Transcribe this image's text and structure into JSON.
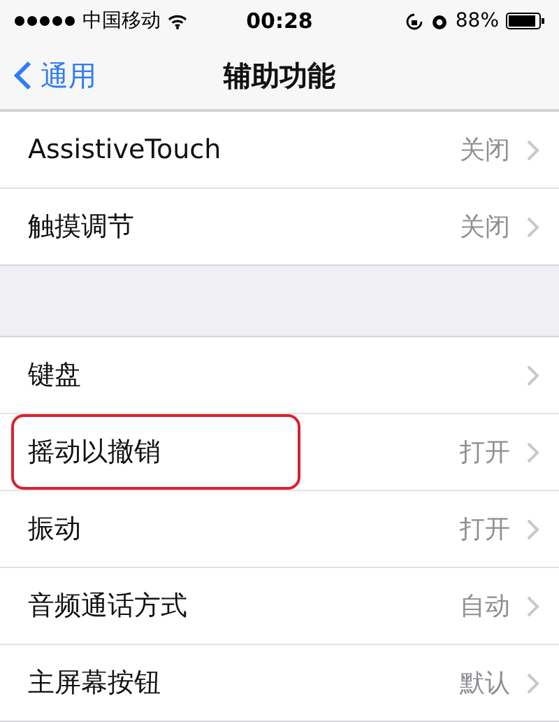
{
  "status_bar": {
    "carrier": "中国移动",
    "time": "00:28",
    "battery": "88%"
  },
  "nav_bar": {
    "back": "通用",
    "title": "辅助功能"
  },
  "groups": [
    {
      "rows": [
        {
          "label": "AssistiveTouch",
          "value": "关闭",
          "highlighted": false
        },
        {
          "label": "触摸调节",
          "value": "关闭",
          "highlighted": false
        }
      ]
    },
    {
      "rows": [
        {
          "label": "键盘",
          "highlighted": false
        },
        {
          "label": "摇动以撤销",
          "value": "打开",
          "highlighted": true
        },
        {
          "label": "振动",
          "value": "打开",
          "highlighted": false
        },
        {
          "label": "音频通话方式",
          "value": "自动",
          "highlighted": false
        },
        {
          "label": "主屏幕按钮",
          "value": "默认",
          "highlighted": false
        }
      ]
    }
  ]
}
